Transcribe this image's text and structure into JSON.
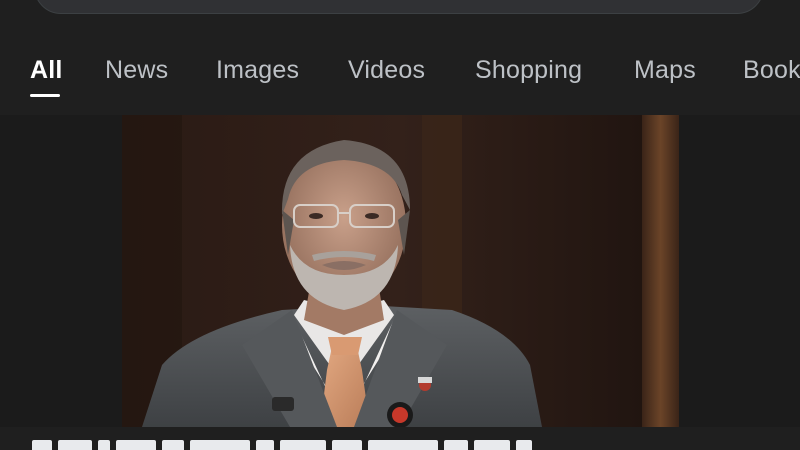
{
  "search": {
    "value": ""
  },
  "tabs": [
    {
      "label": "All",
      "active": true
    },
    {
      "label": "News",
      "active": false
    },
    {
      "label": "Images",
      "active": false
    },
    {
      "label": "Videos",
      "active": false
    },
    {
      "label": "Shopping",
      "active": false
    },
    {
      "label": "Maps",
      "active": false
    },
    {
      "label": "Book",
      "active": false
    }
  ],
  "colors": {
    "background": "#1f1f1f",
    "tab_text": "#bdc1c6",
    "tab_active": "#ffffff"
  },
  "result": {
    "image_icon": "photo"
  }
}
